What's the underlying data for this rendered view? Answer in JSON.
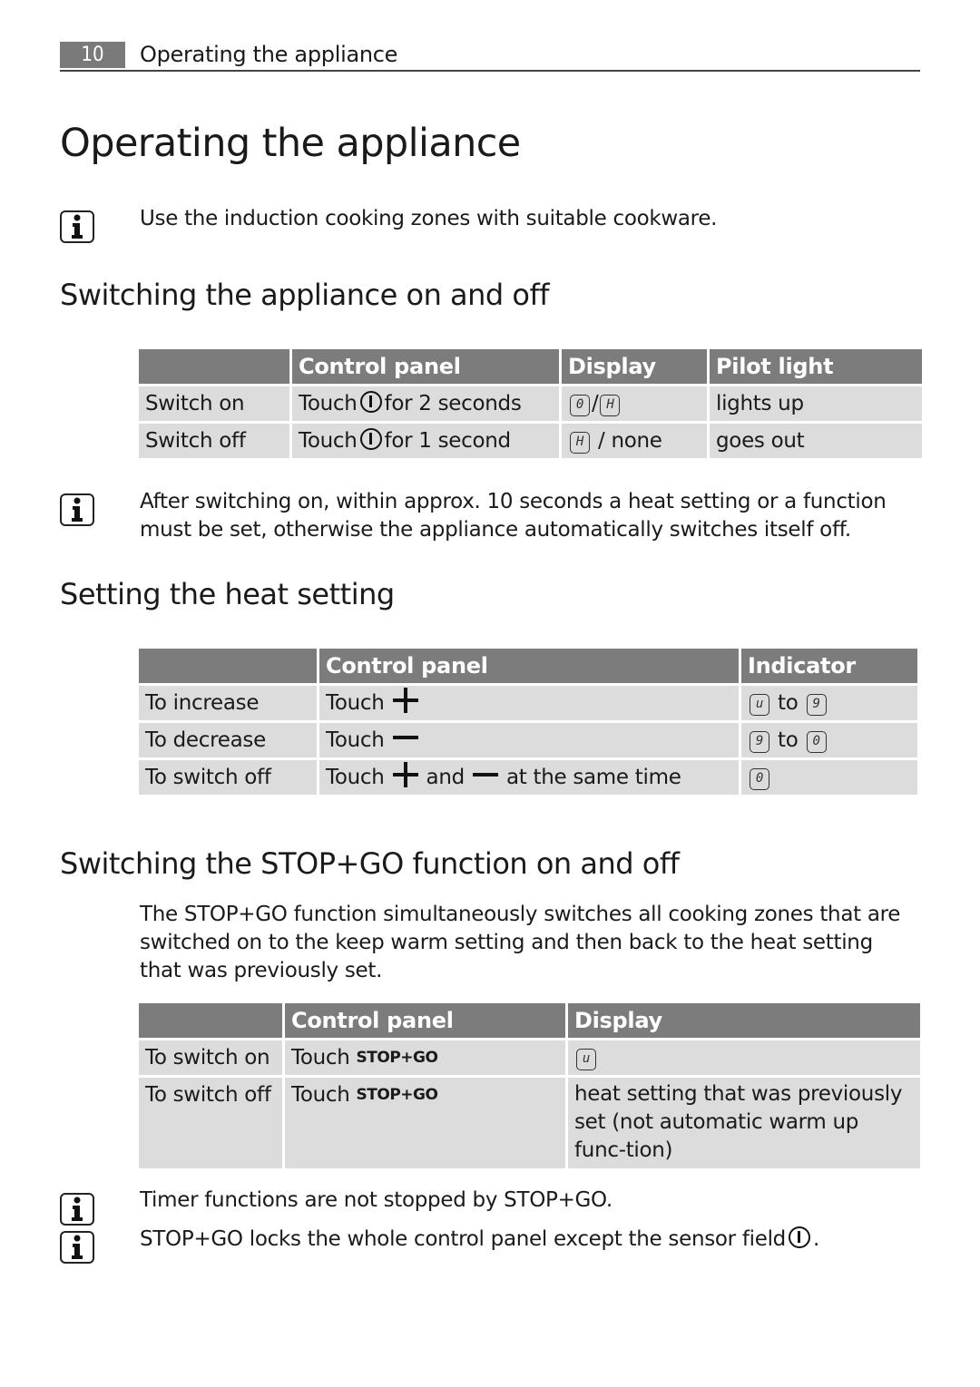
{
  "header": {
    "page_number": "10",
    "title": "Operating the appliance"
  },
  "page_title": "Operating the appliance",
  "notes": {
    "cookware": "Use the induction cooking zones with suitable cookware.",
    "auto_off": "After switching on, within approx. 10 seconds a heat setting or a function must be set, otherwise the appliance automatically switches itself off.",
    "timer": "Timer functions are not stopped by STOP+GO.",
    "lock": "STOP+GO locks the whole control panel except the sensor field"
  },
  "icons": {
    "info": "info-icon",
    "power": "power-sensor-icon",
    "plus": "plus-icon",
    "minus": "minus-icon"
  },
  "section_onoff": {
    "heading": "Switching the appliance on and off",
    "columns": [
      "",
      "Control panel",
      "Display",
      "Pilot light"
    ],
    "rows": [
      {
        "action": "Switch on",
        "touch": "Touch",
        "control_suffix": "for 2 seconds",
        "display_a": "0",
        "display_sep": "/",
        "display_b": "H",
        "pilot": "lights up"
      },
      {
        "action": "Switch off",
        "touch": "Touch",
        "control_suffix": "for 1 second",
        "display_a": "H",
        "display_sep": "/ none",
        "pilot": "goes out"
      }
    ]
  },
  "section_heat": {
    "heading": "Setting the heat setting",
    "columns": [
      "",
      "Control panel",
      "Indicator"
    ],
    "rows": [
      {
        "action": "To increase",
        "touch": "Touch",
        "ind_from": "u",
        "to": "to",
        "ind_to": "9"
      },
      {
        "action": "To decrease",
        "touch": "Touch",
        "ind_from": "9",
        "to": "to",
        "ind_to": "0"
      },
      {
        "action": "To switch off",
        "touch": "Touch",
        "and": "and",
        "suffix": "at the same time",
        "ind_from": "0"
      }
    ]
  },
  "section_stopgo": {
    "heading": "Switching the STOP+GO function on and off",
    "intro": "The STOP+GO function simultaneously switches all cooking zones that are switched on to the keep warm setting and then back to the heat setting that was previously set.",
    "columns": [
      "",
      "Control panel",
      "Display"
    ],
    "rows": [
      {
        "action": "To switch on",
        "touch": "Touch",
        "key": "STOP+GO",
        "display_symbol": "u"
      },
      {
        "action": "To switch off",
        "touch": "Touch",
        "key": "STOP+GO",
        "display_text": "heat setting that was previously set (not automatic warm up func-tion)"
      }
    ]
  },
  "colors": {
    "header_fill": "#7c7c7c",
    "cell_fill": "#dcdcdc",
    "page_tab": "#7a7a7a"
  }
}
